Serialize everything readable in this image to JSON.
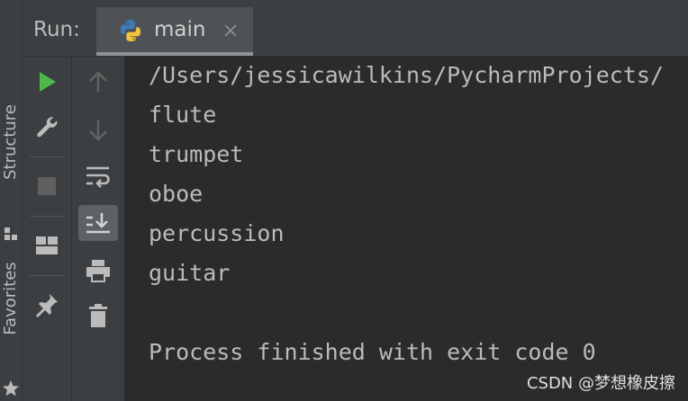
{
  "run_panel": {
    "label": "Run:",
    "tab": {
      "label": "main",
      "icon": "python-icon"
    }
  },
  "side_strip": {
    "structure_label": "Structure",
    "favorites_label": "Favorites"
  },
  "toolbar_left": {
    "buttons": [
      "play-icon",
      "wrench-icon",
      "stop-icon",
      "layout-icon",
      "pin-icon"
    ]
  },
  "toolbar_right": {
    "buttons": [
      "arrow-up-icon",
      "arrow-down-icon",
      "soft-wrap-icon",
      "scroll-to-end-icon",
      "print-icon",
      "trash-icon"
    ]
  },
  "console": {
    "lines": [
      "/Users/jessicawilkins/PycharmProjects/",
      "flute",
      "trumpet",
      "oboe",
      "percussion",
      "guitar",
      "",
      "Process finished with exit code 0"
    ]
  },
  "watermark": "CSDN @梦想橡皮擦",
  "colors": {
    "background": "#2b2b2b",
    "panel": "#3c3f41",
    "play_green": "#4fb84a",
    "text": "#bbbbbb"
  }
}
